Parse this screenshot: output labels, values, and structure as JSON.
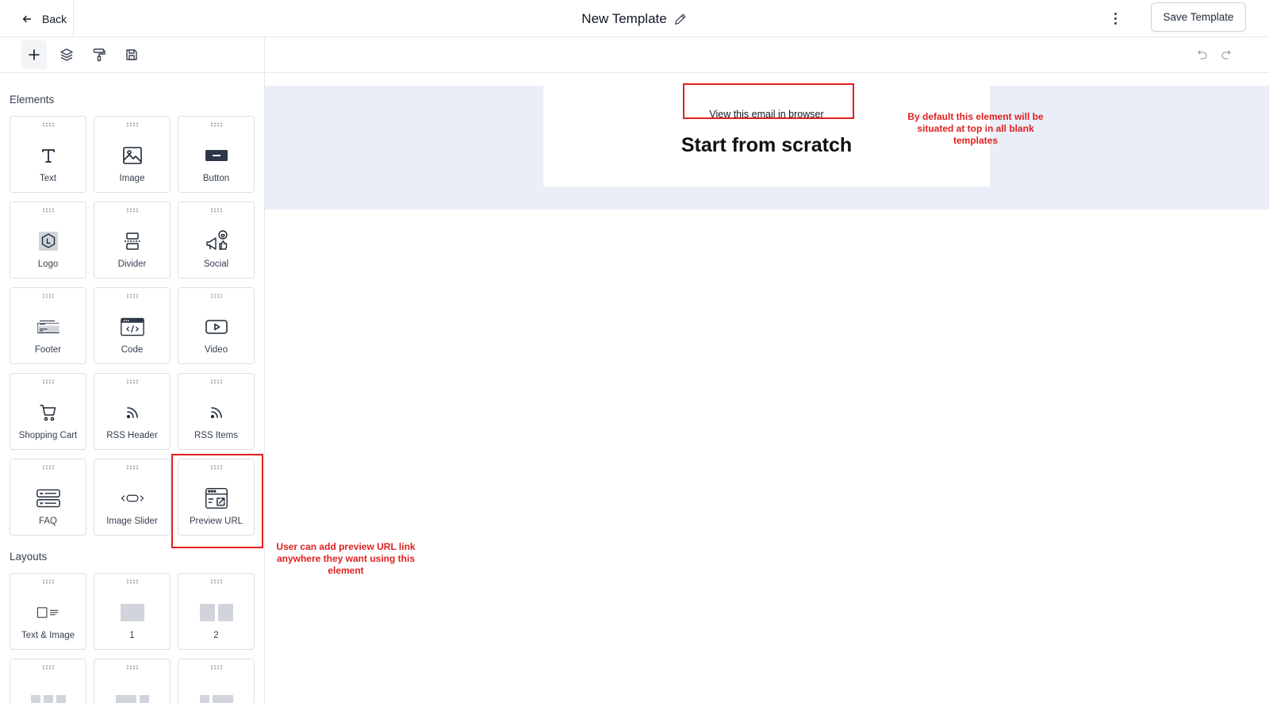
{
  "header": {
    "back_label": "Back",
    "title": "New Template",
    "save_label": "Save Template"
  },
  "toolbar": {
    "tools": [
      "plus-icon",
      "layers-icon",
      "paint-roller-icon",
      "save-icon"
    ]
  },
  "sidebar": {
    "elements_label": "Elements",
    "elements": [
      {
        "label": "Text",
        "icon": "text-icon"
      },
      {
        "label": "Image",
        "icon": "image-icon"
      },
      {
        "label": "Button",
        "icon": "button-icon"
      },
      {
        "label": "Logo",
        "icon": "logo-icon"
      },
      {
        "label": "Divider",
        "icon": "divider-icon"
      },
      {
        "label": "Social",
        "icon": "social-icon"
      },
      {
        "label": "Footer",
        "icon": "footer-icon"
      },
      {
        "label": "Code",
        "icon": "code-icon"
      },
      {
        "label": "Video",
        "icon": "video-icon"
      },
      {
        "label": "Shopping Cart",
        "icon": "cart-icon"
      },
      {
        "label": "RSS Header",
        "icon": "rss-icon"
      },
      {
        "label": "RSS Items",
        "icon": "rss-icon"
      },
      {
        "label": "FAQ",
        "icon": "faq-icon"
      },
      {
        "label": "Image Slider",
        "icon": "slider-icon"
      },
      {
        "label": "Preview URL",
        "icon": "preview-url-icon"
      }
    ],
    "layouts_label": "Layouts",
    "layouts": [
      {
        "label": "Text & Image",
        "icon": "text-image-layout-icon"
      },
      {
        "label": "1",
        "icon": "one-column-icon"
      },
      {
        "label": "2",
        "icon": "two-column-icon"
      }
    ]
  },
  "canvas": {
    "view_in_browser": "View this email in browser",
    "heading": "Start from scratch"
  },
  "annotations": {
    "top_note": "By default this element will be situated at top in all blank templates",
    "preview_note": "User can add preview URL link anywhere they want using this element",
    "color": "#e02020"
  }
}
